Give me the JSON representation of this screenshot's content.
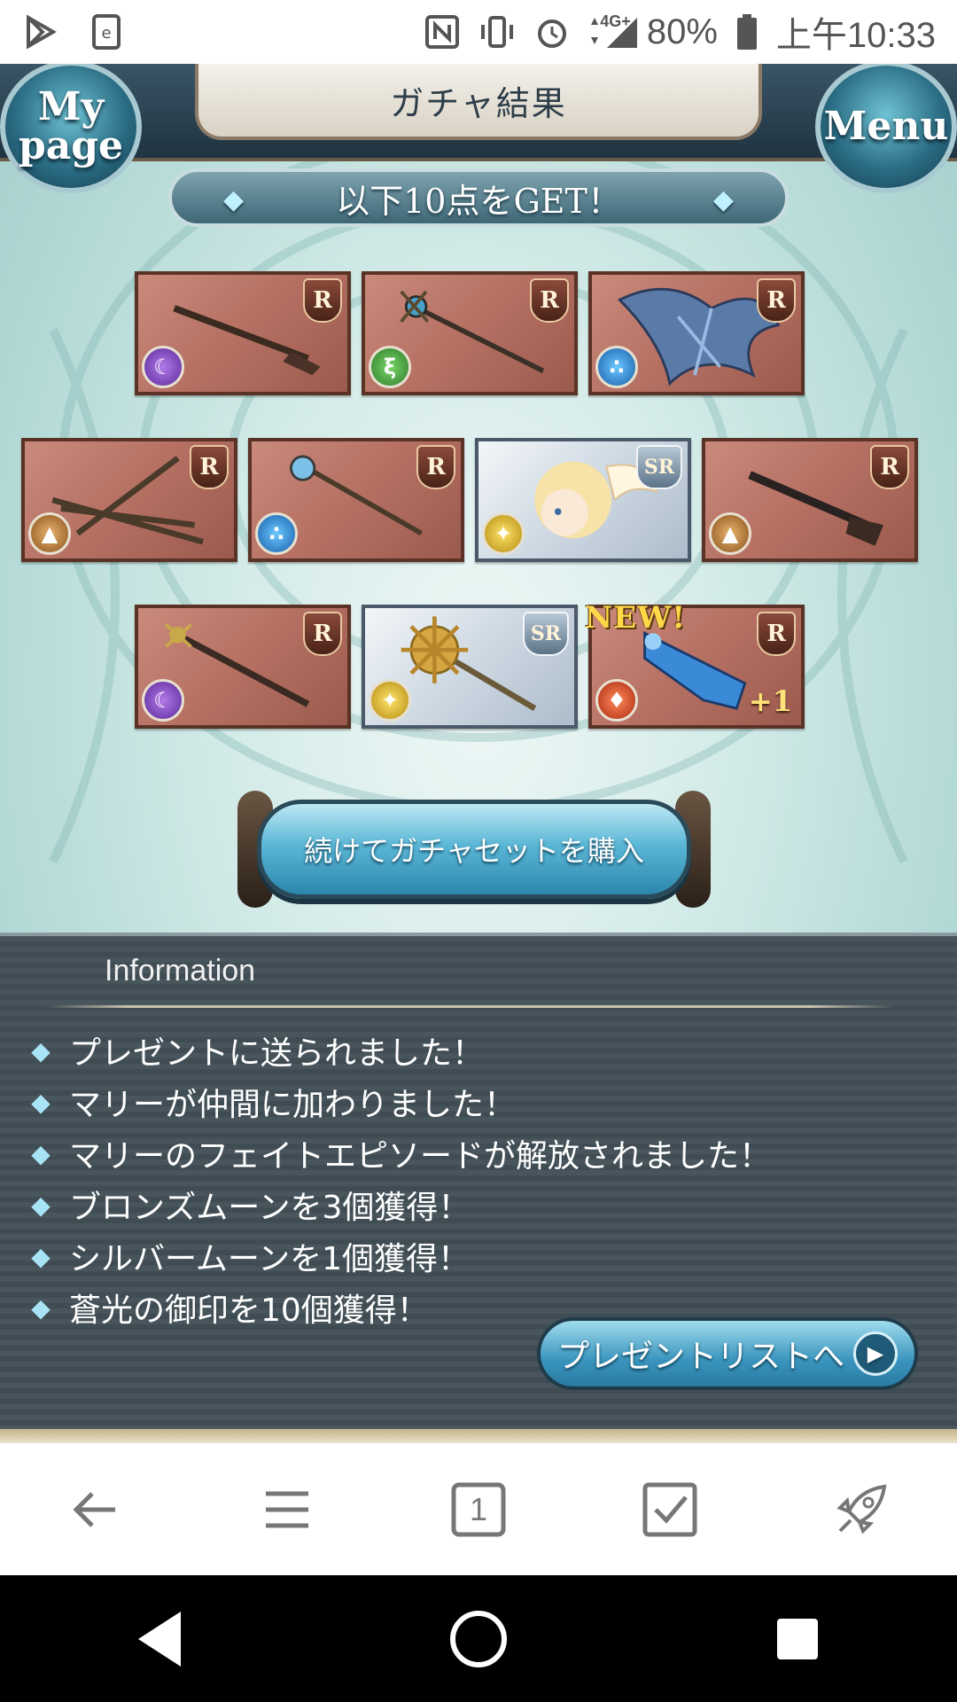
{
  "status_bar": {
    "network": "4G+",
    "battery": "80%",
    "time": "上午10:33"
  },
  "header": {
    "title": "ガチャ結果",
    "mypage_label": "My page",
    "menu_label": "Menu"
  },
  "banner": {
    "text": "以下10点をGET！"
  },
  "items": [
    {
      "rarity": "R",
      "element": "dark",
      "kind": "rifle"
    },
    {
      "rarity": "R",
      "element": "wind",
      "kind": "staff"
    },
    {
      "rarity": "R",
      "element": "water",
      "kind": "dragon"
    },
    {
      "rarity": "R",
      "element": "earth",
      "kind": "crossed-staves"
    },
    {
      "rarity": "R",
      "element": "water",
      "kind": "orb-staff"
    },
    {
      "rarity": "SR",
      "element": "light",
      "kind": "character"
    },
    {
      "rarity": "R",
      "element": "earth",
      "kind": "gun"
    },
    {
      "rarity": "R",
      "element": "dark",
      "kind": "scepter"
    },
    {
      "rarity": "SR",
      "element": "light",
      "kind": "mace"
    },
    {
      "rarity": "R",
      "element": "fire",
      "kind": "blue-gun",
      "plus": "+1",
      "badge": "NEW!"
    }
  ],
  "buy_button": {
    "label": "続けてガチャセットを購入"
  },
  "information": {
    "title": "Information",
    "lines": [
      "プレゼントに送られました！",
      "マリーが仲間に加わりました！",
      "マリーのフェイトエピソードが解放されました！",
      "ブロンズムーンを3個獲得！",
      "シルバームーンを1個獲得！",
      "蒼光の御印を10個獲得！"
    ],
    "present_button": "プレゼントリストへ"
  },
  "browser_toolbar": {
    "tab_count": "1"
  },
  "colors": {
    "accent": "#3a95be",
    "panel": "#48555c",
    "card_r": "#b77264"
  }
}
